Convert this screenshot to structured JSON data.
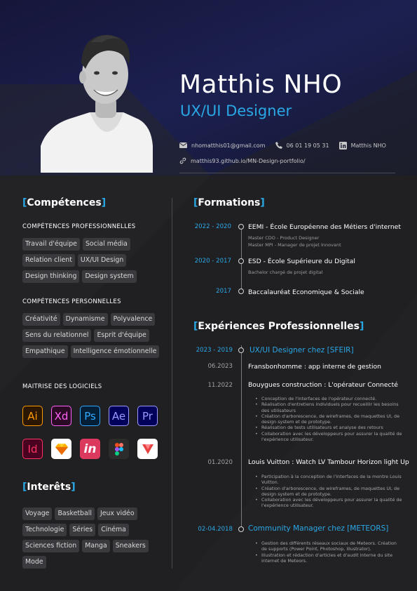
{
  "header": {
    "name": "Matthis NHO",
    "role": "UX/UI Designer",
    "email": "nhomatthis01@gmail.com",
    "phone": "06 01 19 05 31",
    "linkedin": "Matthis NHO",
    "portfolio": "matthis93.github.io/MN-Design-portfolio/"
  },
  "colors": {
    "accent": "#2aa8e6",
    "background": "#1f1f21",
    "tag_bg": "#3a3a3e"
  },
  "competences": {
    "title": "Compétences",
    "pro_title": "COMPÉTENCES PROFESSIONNELLES",
    "pro_tags": [
      "Travail d'équipe",
      "Social média",
      "Relation client",
      "UX/UI Design",
      "Design thinking",
      "Design system"
    ],
    "perso_title": "COMPÉTENCES PERSONNELLES",
    "perso_tags": [
      "Créativité",
      "Dynamisme",
      "Polyvalence",
      "Sens du relationnel",
      "Esprit d'équipe",
      "Empathique",
      "Intelligence émotionnelle"
    ],
    "software_title": "MAITRISE DES LOGICIELS",
    "software": [
      {
        "label": "Ai",
        "icon": "illustrator-icon",
        "fg": "#ff9a00",
        "bg": "#2b1700"
      },
      {
        "label": "Xd",
        "icon": "xd-icon",
        "fg": "#ff61f6",
        "bg": "#2b0a25"
      },
      {
        "label": "Ps",
        "icon": "photoshop-icon",
        "fg": "#31a8ff",
        "bg": "#001e36"
      },
      {
        "label": "Ae",
        "icon": "after-effects-icon",
        "fg": "#9999ff",
        "bg": "#00005b"
      },
      {
        "label": "Pr",
        "icon": "premiere-icon",
        "fg": "#9999ff",
        "bg": "#00005b"
      },
      {
        "label": "Id",
        "icon": "indesign-icon",
        "fg": "#ff3366",
        "bg": "#49021f"
      },
      {
        "label": "",
        "icon": "sketch-icon",
        "fg": "#fdad00",
        "bg": "#ffffff"
      },
      {
        "label": "in",
        "icon": "invision-icon",
        "fg": "#ffffff",
        "bg": "#dc395f"
      },
      {
        "label": "",
        "icon": "figma-icon",
        "fg": "#ffffff",
        "bg": "#2c2c2c"
      },
      {
        "label": "",
        "icon": "framer-icon",
        "fg": "#e84142",
        "bg": "#ffffff"
      }
    ]
  },
  "interets": {
    "title": "Interêts",
    "tags": [
      "Voyage",
      "Basketball",
      "Jeux vidéo",
      "Technologie",
      "Séries",
      "Cinéma",
      "Sciences fiction",
      "Manga",
      "Sneakers",
      "Mode"
    ]
  },
  "formations": {
    "title": "Formations",
    "items": [
      {
        "date": "2022 - 2020",
        "title": "EEMI - École Européenne des Métiers d'internet",
        "sub1": "Master CDO - Product Designer",
        "sub2": "Master MPI - Manager de projet Innovant"
      },
      {
        "date": "2020 - 2017",
        "title": "ESD - École Supérieure du Digital",
        "sub1": "Bachelor chargé de projet digital"
      },
      {
        "date": "2017",
        "title": "Baccalauréat Economique & Sociale"
      }
    ]
  },
  "experiences": {
    "title": "Expériences Professionnelles",
    "sfeir": {
      "date": "2023 - 2019",
      "title": "UX/UI Designer chez [SFEIR]"
    },
    "fransbonhomme": {
      "date": "06.2023",
      "title": "Fransbonhomme : app interne de gestion"
    },
    "bouygues": {
      "date": "11.2022",
      "title": "Bouygues construction : L'opérateur Connecté",
      "bullets": [
        "Conception de l'interfaces de l'opérateur connecté.",
        "Réalisation d'entretiens individuels pour recueillir les besoins des utilisateurs",
        "Création d'arborescence, de wireframes, de maquettes UI, de design system et de prototype.",
        "Réalisation de tests utilisateurs et analyse des retours",
        "Collaboration avec les développeurs pour assurer la qualité de l'expérience utilisateur."
      ]
    },
    "vuitton": {
      "date": "01.2020",
      "title": "Louis Vuitton : Watch LV Tambour Horizon light Up",
      "bullets": [
        "Participation à la conception de l'interfaces de la montre Louis Vuitton.",
        "Création d'arborescence, de wireframes, de maquettes UI, de design system et de prototype.",
        "Collaboration avec les développeurs pour assurer la qualité de l'expérience utilisateur."
      ]
    },
    "meteors": {
      "date": "02-04.2018",
      "title": "Community Manager chez [METEORS]",
      "bullets": [
        "Gestion des différents réseaux sociaux de Meteors. Création de supports (Power Point, Photoshop, Illustrator).",
        "Illustration et rédaction d'articles et d'audit interne du site internet de Meteors."
      ]
    }
  }
}
